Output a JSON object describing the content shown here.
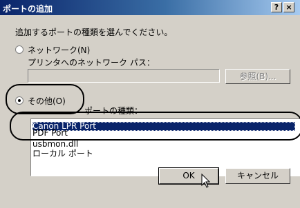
{
  "window": {
    "title": "ポートの追加",
    "help_button": "?",
    "close_button": "×"
  },
  "instruction": "追加するポートの種類を選んでください。",
  "network": {
    "radio_label": "ネットワーク(N)",
    "path_label": "プリンタへのネットワーク パス：",
    "path_value": "",
    "browse_button": "参照(B)..."
  },
  "other": {
    "radio_label": "その他(O)",
    "type_label": "ポートの種類：",
    "port_types": [
      "Canon LPR Port",
      "PDF Port",
      "usbmon.dll",
      "ローカル ポート"
    ],
    "selected_index": 0
  },
  "buttons": {
    "ok": "OK",
    "cancel": "キャンセル"
  }
}
